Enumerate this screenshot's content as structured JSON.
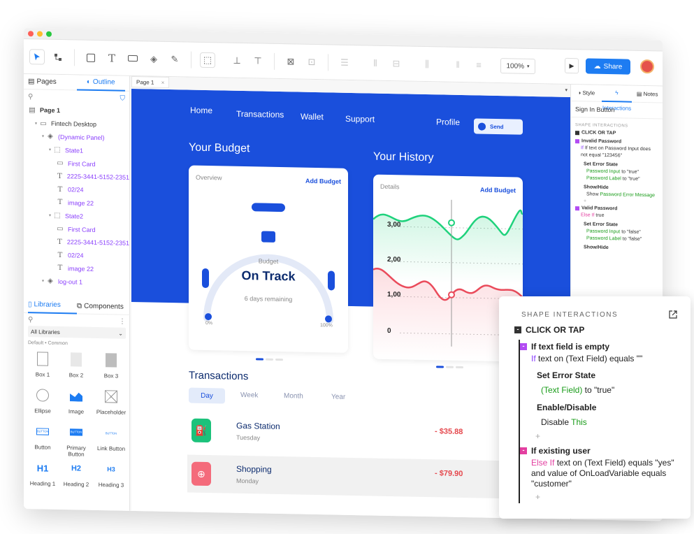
{
  "left_panel": {
    "tabs": [
      "Pages",
      "Outline"
    ],
    "tree": [
      {
        "label": "Page 1",
        "icon": "page-icon",
        "indent": 0,
        "bold": true
      },
      {
        "label": "Fintech Desktop",
        "icon": "folder-icon",
        "indent": 1
      },
      {
        "label": "(Dynamic Panel)",
        "icon": "layers-icon",
        "indent": 2,
        "purple": true
      },
      {
        "label": "State1",
        "icon": "state-icon",
        "indent": 3,
        "purple": true
      },
      {
        "label": "First Card",
        "icon": "rect-icon",
        "indent": 4,
        "purple": true
      },
      {
        "label": "2225-3441-5152-2351",
        "icon": "text-icon",
        "indent": 4,
        "purple": true
      },
      {
        "label": "02/24",
        "icon": "text-icon",
        "indent": 4,
        "purple": true
      },
      {
        "label": "image 22",
        "icon": "text-icon",
        "indent": 4,
        "purple": true
      },
      {
        "label": "State2",
        "icon": "state-icon",
        "indent": 3,
        "purple": true
      },
      {
        "label": "First Card",
        "icon": "rect-icon",
        "indent": 4,
        "purple": true
      },
      {
        "label": "2225-3441-5152-2351",
        "icon": "text-icon",
        "indent": 4,
        "purple": true
      },
      {
        "label": "02/24",
        "icon": "text-icon",
        "indent": 4,
        "purple": true
      },
      {
        "label": "image 22",
        "icon": "text-icon",
        "indent": 4,
        "purple": true
      },
      {
        "label": "log-out 1",
        "icon": "layers-icon",
        "indent": 2,
        "purple": true
      }
    ],
    "lib_tabs": [
      "Libraries",
      "Components"
    ],
    "lib_select": "All Libraries",
    "lib_category": "Default • Common",
    "tiles": [
      {
        "label": "Box 1",
        "shape": "box1"
      },
      {
        "label": "Box 2",
        "shape": "box2"
      },
      {
        "label": "Box 3",
        "shape": "box3"
      },
      {
        "label": "Ellipse",
        "shape": "ellipse"
      },
      {
        "label": "Image",
        "shape": "image"
      },
      {
        "label": "Placeholder",
        "shape": "placeholder"
      },
      {
        "label": "Button",
        "shape": "button"
      },
      {
        "label": "Primary Button",
        "shape": "primary"
      },
      {
        "label": "Link Button",
        "shape": "link"
      },
      {
        "label": "Heading 1",
        "shape": "h1"
      },
      {
        "label": "Heading 2",
        "shape": "h2"
      },
      {
        "label": "Heading 3",
        "shape": "h3"
      }
    ],
    "tile_text": {
      "button": "BUTTON",
      "h1": "H1",
      "h2": "H2",
      "h3": "H3"
    }
  },
  "toolbar": {
    "zoom": "100%",
    "share_label": "Share"
  },
  "canvas": {
    "tab_label": "Page 1",
    "nav": {
      "home": "Home",
      "transactions": "Transactions",
      "wallet": "Wallet",
      "support": "Support",
      "profile": "Profile",
      "send": "Send"
    },
    "budget": {
      "heading": "Your Budget",
      "card_label": "Overview",
      "add": "Add Budget",
      "title": "Budget",
      "status": "On Track",
      "sub": "6 days remaining",
      "min": "0%",
      "max": "100%"
    },
    "history": {
      "heading": "Your History",
      "card_label": "Details",
      "add": "Add Budget",
      "ticks": [
        "3,00",
        "2,00",
        "1,00",
        "0"
      ]
    },
    "transactions": {
      "heading": "Transactions",
      "tabs": [
        "Day",
        "Week",
        "Month",
        "Year"
      ],
      "items": [
        {
          "name": "Gas Station",
          "day": "Tuesday",
          "amount": "- $35.88",
          "color": "#1cc27b"
        },
        {
          "name": "Shopping",
          "day": "Monday",
          "amount": "- $79.90",
          "color": "#f46b7b"
        }
      ]
    }
  },
  "right_panel": {
    "tabs": [
      "Style",
      "Interactions",
      "Notes"
    ],
    "name": "Sign In Button",
    "section": "SHAPE INTERACTIONS",
    "event": "CLICK OR TAP",
    "case1_title": "Invalid Password",
    "case1_cond": "If text on Password Input does not equal \"123456\"",
    "action1": "Set Error State",
    "a1_l1_green": "Password Input",
    "a1_l1_rest": " to \"true\"",
    "a1_l2_green": "Password Label",
    "a1_l2_rest": " to \"true\"",
    "action2": "Show/Hide",
    "a2_l1_pre": "Show ",
    "a2_l1_green": "Password Error Message",
    "case2_title": "Valid Password",
    "case2_cond_kw": "Else If",
    "case2_cond_rest": " true",
    "action3": "Set Error State",
    "a3_l1_green": "Password Input",
    "a3_l1_rest": " to \"false\"",
    "a3_l2_green": "Password Label",
    "a3_l2_rest": " to \"false\"",
    "action4": "Show/Hide"
  },
  "popup": {
    "section": "SHAPE INTERACTIONS",
    "event": "CLICK OR TAP",
    "case1_title": "If text field is empty",
    "case1_kw": "If",
    "case1_rest": " text on (Text Field) equals \"\"",
    "action1": "Set Error State",
    "action1_green": "(Text Field)",
    "action1_rest": " to \"true\"",
    "action2": "Enable/Disable",
    "action2_pre": "Disable ",
    "action2_green": "This",
    "case2_title": "If existing user",
    "case2_kw": "Else If",
    "case2_rest": " text on (Text Field) equals \"yes\" and value of OnLoadVariable equals \"customer\"",
    "plus": "+"
  },
  "colors": {
    "brand": "#1a4fdc",
    "accent": "#1d7cf2",
    "green": "#1a9c1a",
    "magenta": "#e33fa0",
    "purple": "#8a3ffc",
    "negative": "#e5484d"
  }
}
